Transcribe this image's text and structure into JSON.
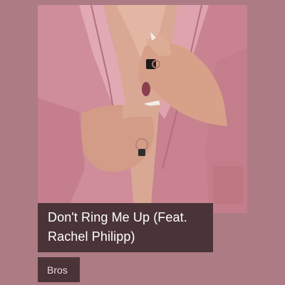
{
  "theme": {
    "background": "#ad7b83",
    "label_background": "#4a3437",
    "title_color": "#ffffff",
    "artist_color": "#ead8dc"
  },
  "cover": {
    "image_icon": "album-cover-photo"
  },
  "track": {
    "title": "Don't Ring Me Up (Feat. Rachel Philipp)",
    "artist": "Bros"
  }
}
